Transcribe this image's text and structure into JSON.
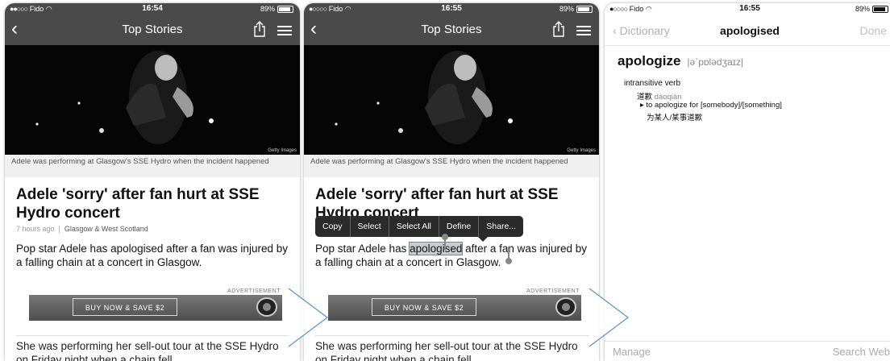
{
  "status": {
    "carrier": "Fido",
    "battery": "89%",
    "times": [
      "16:54",
      "16:55",
      "16:55"
    ]
  },
  "article": {
    "nav_title": "Top Stories",
    "photo_credit": "Getty Images",
    "caption": "Adele was performing at Glasgow's SSE Hydro when the incident happened",
    "headline": "Adele 'sorry' after fan hurt at SSE Hydro concert",
    "meta_time": "7 hours ago",
    "meta_region": "Glasgow & West Scotland",
    "lead": "Pop star Adele has apologised after a fan was injured by a falling chain at a concert in Glasgow.",
    "lead_before": "Pop star Adele has ",
    "lead_selected": "apologised",
    "lead_after": " after a fan was injured by a falling chain at a concert in Glasgow.",
    "ad_label": "ADVERTISEMENT",
    "ad_button": "BUY NOW & SAVE $2",
    "body": "She was performing her sell-out tour at the SSE Hydro on Friday night when a chain fell"
  },
  "callout_menu": [
    "Copy",
    "Select",
    "Select All",
    "Define",
    "Share..."
  ],
  "dictionary": {
    "back_label": "Dictionary",
    "title": "apologised",
    "done_label": "Done",
    "headword": "apologize",
    "pronunciation": "|əˈpɒlədʒaɪz|",
    "part_of_speech": "intransitive verb",
    "sense_zh": "道歉",
    "sense_pinyin": "dàoqiàn",
    "example_en": "▸ to apologize for [somebody]/[something]",
    "example_zh": "为某人/某事道歉",
    "footer_left": "Manage",
    "footer_right": "Search Web"
  },
  "colors": {
    "nav_bg": "#4a4a4a",
    "arrow_stroke": "#5a8fd0",
    "selection": "#c9cdd2"
  }
}
